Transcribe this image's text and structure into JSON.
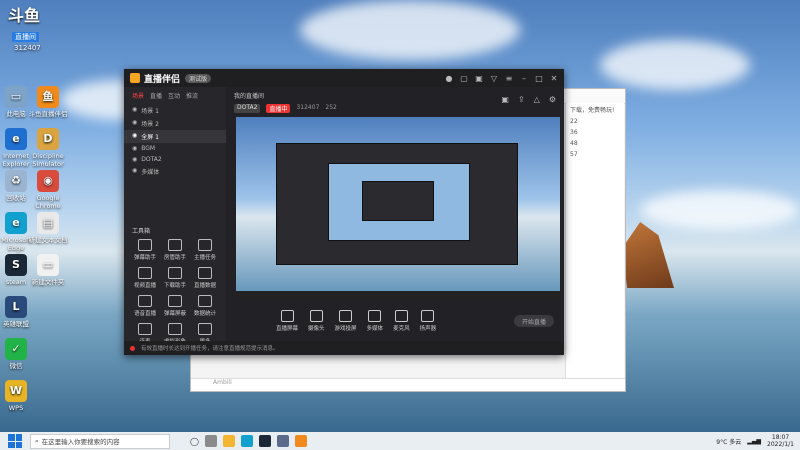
{
  "brand": {
    "logo_text": "斗鱼",
    "tag": "直播间",
    "room_id": "312407"
  },
  "desktop_icons": [
    {
      "label": "此电脑",
      "icon": "computer-icon",
      "color": "#7da3c9",
      "glyph": "▭"
    },
    {
      "label": "Internet Explorer",
      "icon": "ie-icon",
      "color": "#1f6fd0",
      "glyph": "e"
    },
    {
      "label": "回收站",
      "icon": "recycle-bin-icon",
      "color": "#9bb4cf",
      "glyph": "♻"
    },
    {
      "label": "Microsoft Edge",
      "icon": "edge-icon",
      "color": "#12a1cf",
      "glyph": "e"
    },
    {
      "label": "steam",
      "icon": "steam-icon",
      "color": "#1b2838",
      "glyph": "S"
    },
    {
      "label": "英雄联盟",
      "icon": "game-icon",
      "color": "#294a7a",
      "glyph": "L"
    },
    {
      "label": "微信",
      "icon": "wechat-icon",
      "color": "#21b348",
      "glyph": "✓"
    },
    {
      "label": "WPS",
      "icon": "wps-icon",
      "color": "#e8b324",
      "glyph": "W"
    }
  ],
  "desktop_icons_col2": [
    {
      "label": "斗鱼直播伴侣",
      "icon": "douyu-icon",
      "color": "#f08a1c",
      "glyph": "鱼"
    },
    {
      "label": "Discipline Simulator",
      "icon": "d-icon",
      "color": "#d9a441",
      "glyph": "D"
    },
    {
      "label": "Google Chrome",
      "icon": "chrome-icon",
      "color": "#d94b3d",
      "glyph": "◉"
    },
    {
      "label": "新建文本文档",
      "icon": "document-icon",
      "color": "#e9e9e9",
      "glyph": "▤"
    },
    {
      "label": "新建文件夹",
      "icon": "folder-icon",
      "color": "#f1f1f1",
      "glyph": "▭"
    }
  ],
  "app": {
    "title": "直播伴侣",
    "version": "测试版",
    "stream_title": "我的直播间",
    "category": "DOTA2",
    "live_label": "直播中",
    "room_id": "312407",
    "hot": "252",
    "left_tabs": [
      "场景",
      "直播",
      "互动",
      "推流"
    ],
    "scenes": [
      "场景 1",
      "场景 2",
      "全屏 1",
      "BGM",
      "DOTA2",
      "多媒体"
    ],
    "tools_header": "工具箱",
    "tools": [
      "弹幕助手",
      "房管助手",
      "主播任务",
      "视频直播",
      "下载助手",
      "直播数据",
      "语音直播",
      "弹幕屏蔽",
      "数据统计",
      "连麦",
      "虚拟形象",
      "更多"
    ],
    "bottom_tools": [
      "直播屏幕",
      "摄像头",
      "游戏投屏",
      "多媒体",
      "麦克风",
      "扬声器"
    ],
    "start_button": "开始直播",
    "footer_notice": "有效直播时长达到开播任务，请注意直播规范提示消息。"
  },
  "bgwin": {
    "side_rows": [
      "下载，免费畅玩!",
      "22",
      "36",
      "48",
      "57"
    ],
    "input_placeholder": "Ambili"
  },
  "taskbar": {
    "search_placeholder": "在这里输入你要搜索的内容",
    "weather": "9°C 多云",
    "time": "18:07",
    "date": "2022/1/1"
  }
}
